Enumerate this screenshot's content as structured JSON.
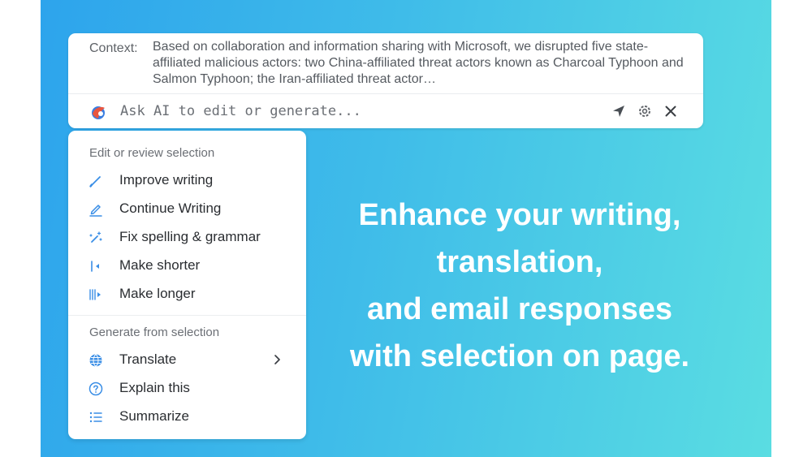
{
  "context": {
    "label": "Context:",
    "text": "Based on collaboration and information sharing with Microsoft, we disrupted five state-affiliated malicious actors: two China-affiliated threat actors known as Charcoal Typhoon and Salmon Typhoon; the Iran-affiliated threat actor…"
  },
  "ask": {
    "placeholder": "Ask AI to edit or generate...",
    "icons": [
      "logo-icon",
      "send-icon",
      "gear-icon",
      "close-icon"
    ]
  },
  "menu": {
    "edit_section_title": "Edit or review selection",
    "edit_items": [
      {
        "label": "Improve writing",
        "icon": "pen-icon"
      },
      {
        "label": "Continue Writing",
        "icon": "pencil-icon"
      },
      {
        "label": "Fix spelling & grammar",
        "icon": "magic-wand-icon"
      },
      {
        "label": "Make shorter",
        "icon": "shorten-icon"
      },
      {
        "label": "Make longer",
        "icon": "lengthen-icon"
      }
    ],
    "generate_section_title": "Generate from selection",
    "generate_items": [
      {
        "label": "Translate",
        "icon": "globe-icon",
        "has_submenu": true
      },
      {
        "label": "Explain this",
        "icon": "question-icon"
      },
      {
        "label": "Summarize",
        "icon": "list-icon"
      }
    ]
  },
  "headline": {
    "lines": [
      "Enhance your writing,",
      "translation,",
      "and email responses",
      "with selection on page."
    ]
  },
  "colors": {
    "accent_blue": "#3a8ee6",
    "gradient_start": "#2da4ec",
    "gradient_end": "#5adde2",
    "logo_red": "#e8553f"
  }
}
